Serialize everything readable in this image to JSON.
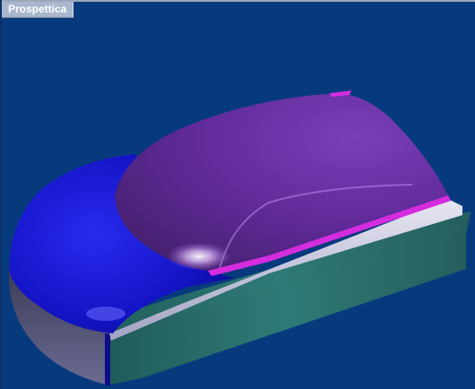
{
  "viewport": {
    "tab_label": "Prospettica",
    "background": "#073a7d"
  },
  "model": {
    "colors": {
      "front_hood": "#1414c8",
      "canopy": "#6d2fa8",
      "accent_trim": "#d62cdf",
      "side_band": "#c9c9de",
      "lower_body": "#2b6a68"
    }
  }
}
